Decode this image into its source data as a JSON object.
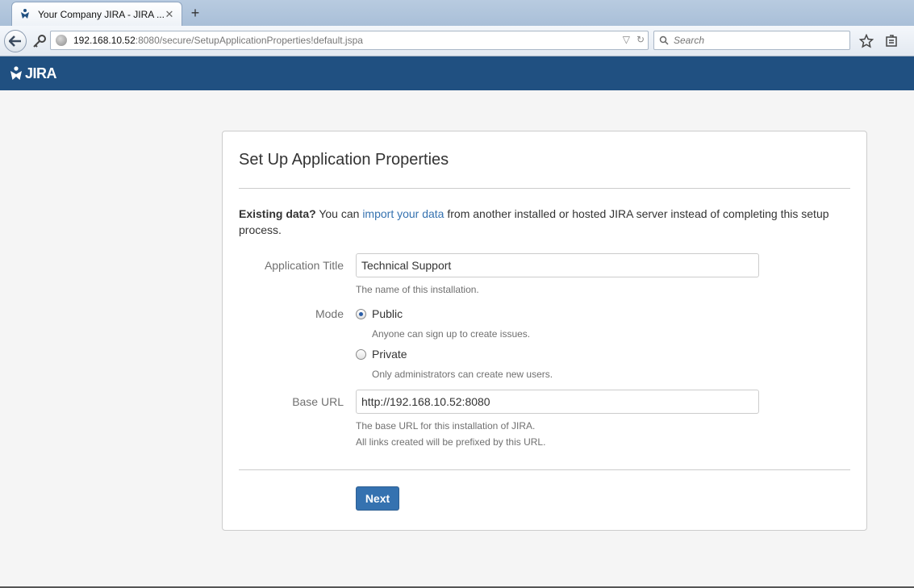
{
  "browser": {
    "tab_title": "Your Company JIRA - JIRA ...",
    "url_host": "192.168.10.52",
    "url_rest": ":8080/secure/SetupApplicationProperties!default.jspa",
    "search_placeholder": "Search"
  },
  "header": {
    "logo_text": "JIRA",
    "bg_color": "#205081"
  },
  "setup": {
    "title": "Set Up Application Properties",
    "intro_bold": "Existing data?",
    "intro_before_link": " You can ",
    "intro_link": "import your data",
    "intro_after_link": " from another installed or hosted JIRA server instead of completing this setup process.",
    "app_title_label": "Application Title",
    "app_title_value": "Technical Support",
    "app_title_desc": "The name of this installation.",
    "mode_label": "Mode",
    "mode_options": [
      {
        "label": "Public",
        "desc": "Anyone can sign up to create issues.",
        "checked": true
      },
      {
        "label": "Private",
        "desc": "Only administrators can create new users.",
        "checked": false
      }
    ],
    "base_url_label": "Base URL",
    "base_url_value": "http://192.168.10.52:8080",
    "base_url_desc1": "The base URL for this installation of JIRA.",
    "base_url_desc2": "All links created will be prefixed by this URL.",
    "next_label": "Next",
    "button_color": "#3572b0"
  }
}
